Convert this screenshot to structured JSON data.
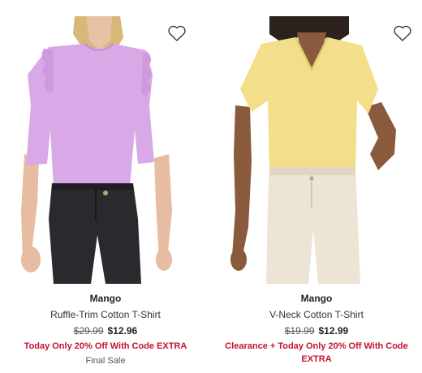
{
  "products": [
    {
      "brand": "Mango",
      "name": "Ruffle-Trim Cotton T-Shirt",
      "original_price": "$29.99",
      "sale_price": "$12.96",
      "promo": "Today Only 20% Off With Code EXTRA",
      "note": "Final Sale",
      "image": "woman in lilac ruffle long-sleeve top and black jeans",
      "wishlist_icon": "heart-outline"
    },
    {
      "brand": "Mango",
      "name": "V-Neck Cotton T-Shirt",
      "original_price": "$19.99",
      "sale_price": "$12.99",
      "promo": "Clearance + Today Only 20% Off With Code EXTRA",
      "image": "woman in yellow v-neck tee and cream jeans",
      "wishlist_icon": "heart-outline"
    }
  ],
  "colors": {
    "promo": "#c41230",
    "top_left": "#d9a8e6",
    "top_right": "#f3de8a",
    "jeans_left": "#2a2a2e",
    "jeans_right": "#ece4d4"
  }
}
